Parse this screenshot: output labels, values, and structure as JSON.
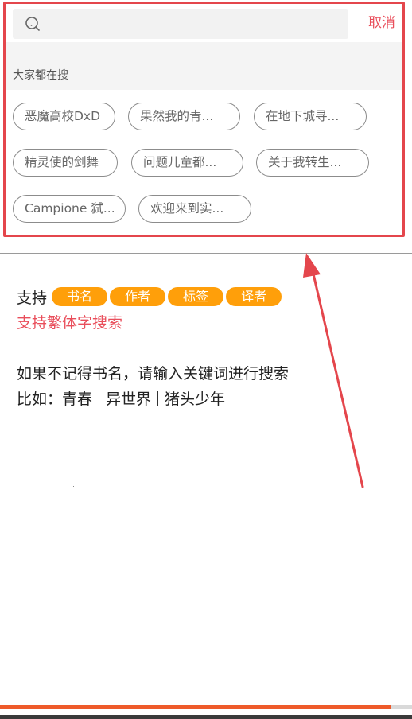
{
  "search": {
    "placeholder": "",
    "value": "",
    "cancel_label": "取消"
  },
  "hot": {
    "title": "大家都在搜",
    "tags": [
      "恶魔高校DxD",
      "果然我的青...",
      "在地下城寻...",
      "精灵使的剑舞",
      "问题儿童都...",
      "关于我转生...",
      "Campione 弑...",
      "欢迎来到实..."
    ]
  },
  "tips": {
    "support_label": "支持",
    "support_types": [
      "书名",
      "作者",
      "标签",
      "译者"
    ],
    "traditional_note": "支持繁体字搜索",
    "hint": "如果不记得书名，请输入关键词进行搜索",
    "example_prefix": "比如：",
    "examples": [
      "青春",
      "异世界",
      "猪头少年"
    ]
  },
  "colors": {
    "accent": "#e94e5b",
    "badge": "#ff9f0a",
    "highlight": "#e4464c",
    "progress": "#ee5a2a"
  },
  "progress": {
    "fraction": 0.95
  }
}
